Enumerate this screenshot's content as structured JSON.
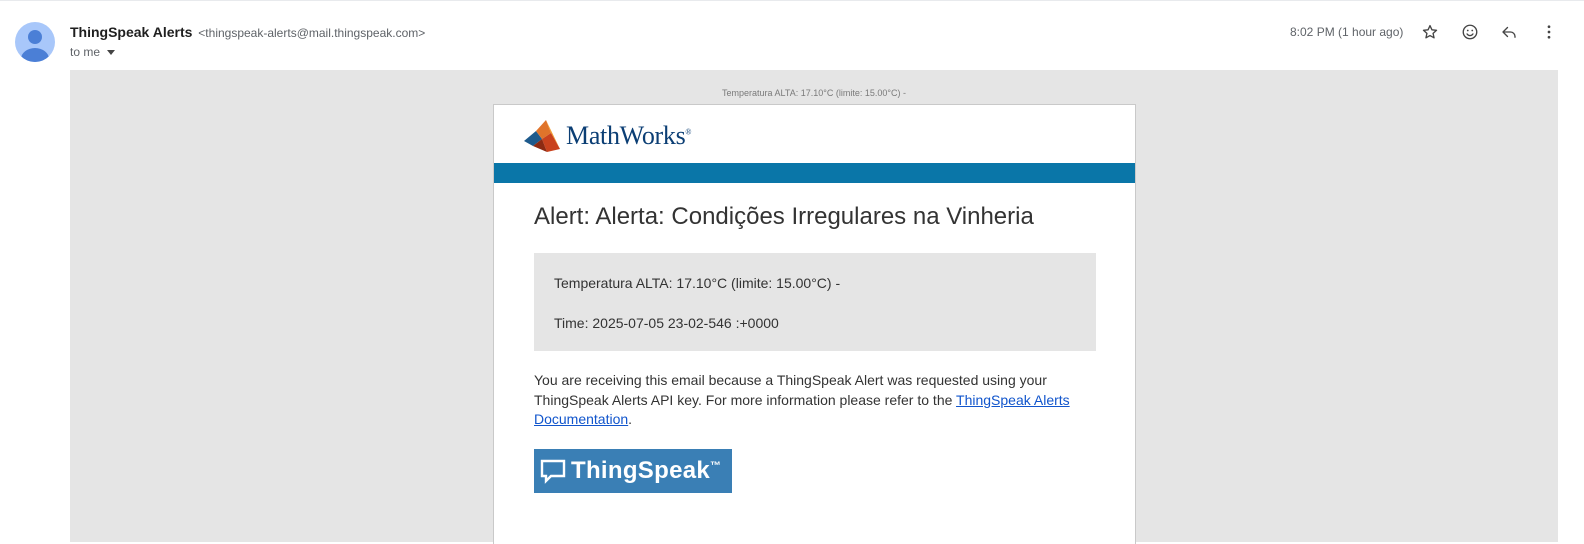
{
  "header": {
    "sender_name": "ThingSpeak Alerts",
    "sender_email": "<thingspeak-alerts@mail.thingspeak.com>",
    "recipient": "to me",
    "time": "8:02 PM (1 hour ago)",
    "icons": [
      "star-icon",
      "emoji-icon",
      "reply-icon",
      "more-vert-icon"
    ]
  },
  "email": {
    "preheader": "Temperatura ALTA: 17.10°C (limite: 15.00°C) -",
    "brand": "MathWorks",
    "brand_mark": "®",
    "title": "Alert: Alerta: Condições Irregulares na Vinheria",
    "message_line1": "Temperatura ALTA: 17.10°C (limite: 15.00°C) -",
    "message_line2": "Time: 2025-07-05 23-02-546 :+0000",
    "info_text": "You are receiving this email because a ThingSpeak Alert was requested using your ThingSpeak Alerts API key. For more information please refer to the ",
    "info_link": "ThingSpeak Alerts Documentation",
    "info_end": ".",
    "footer_logo": "ThingSpeak",
    "footer_tm": "™"
  },
  "colors": {
    "accent_bar": "#0a76a8",
    "mathworks_text": "#0b3e74",
    "thingspeak_bg": "#3a7fb5",
    "link": "#1155cc",
    "avatar": "#a8c7fa"
  }
}
